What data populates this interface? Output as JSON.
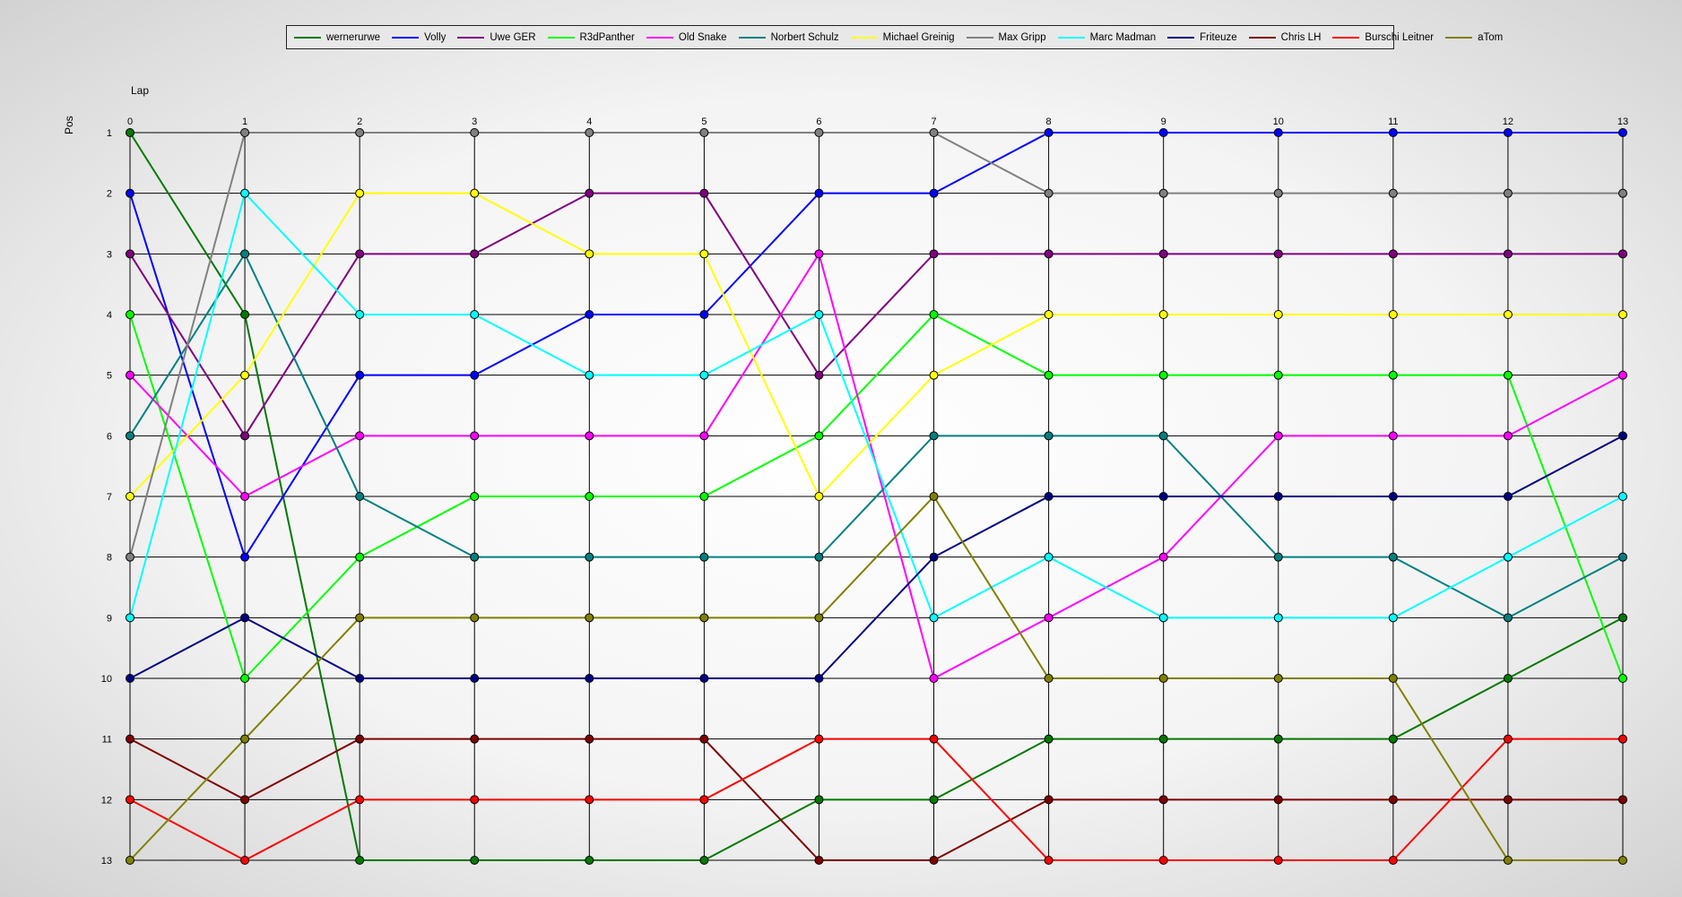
{
  "chart_data": {
    "type": "line",
    "title": "",
    "xlabel": "Lap",
    "ylabel": "Pos",
    "x": [
      0,
      1,
      2,
      3,
      4,
      5,
      6,
      7,
      8,
      9,
      10,
      11,
      12,
      13
    ],
    "y_ticks": [
      1,
      2,
      3,
      4,
      5,
      6,
      7,
      8,
      9,
      10,
      11,
      12,
      13
    ],
    "ylim": [
      1,
      13
    ],
    "y_inverted": true,
    "grid": true,
    "legend_position": "top-center",
    "series": [
      {
        "name": "wernerurwe",
        "color": "#007a00",
        "values": [
          1,
          4,
          13,
          13,
          13,
          13,
          12,
          12,
          11,
          11,
          11,
          11,
          10,
          9
        ]
      },
      {
        "name": "Volly",
        "color": "#0000ff",
        "values": [
          2,
          8,
          5,
          5,
          4,
          4,
          2,
          2,
          1,
          1,
          1,
          1,
          1,
          1
        ]
      },
      {
        "name": "Uwe GER",
        "color": "#800080",
        "values": [
          3,
          6,
          3,
          3,
          2,
          2,
          5,
          3,
          3,
          3,
          3,
          3,
          3,
          3
        ]
      },
      {
        "name": "R3dPanther",
        "color": "#00ff00",
        "values": [
          4,
          10,
          8,
          7,
          7,
          7,
          6,
          4,
          5,
          5,
          5,
          5,
          5,
          10
        ]
      },
      {
        "name": "Old Snake",
        "color": "#ff00ff",
        "values": [
          5,
          7,
          6,
          6,
          6,
          6,
          3,
          10,
          9,
          8,
          6,
          6,
          6,
          5
        ]
      },
      {
        "name": "Norbert Schulz",
        "color": "#008080",
        "values": [
          6,
          3,
          7,
          8,
          8,
          8,
          8,
          6,
          6,
          6,
          8,
          8,
          9,
          8
        ]
      },
      {
        "name": "Michael Greinig",
        "color": "#ffff00",
        "values": [
          7,
          5,
          2,
          2,
          3,
          3,
          7,
          5,
          4,
          4,
          4,
          4,
          4,
          4
        ]
      },
      {
        "name": "Max Gripp",
        "color": "#808080",
        "values": [
          8,
          1,
          1,
          1,
          1,
          1,
          1,
          1,
          2,
          2,
          2,
          2,
          2,
          2
        ]
      },
      {
        "name": "Marc Madman",
        "color": "#00ffff",
        "values": [
          9,
          2,
          4,
          4,
          5,
          5,
          4,
          9,
          8,
          9,
          9,
          9,
          8,
          7
        ]
      },
      {
        "name": "Friteuze",
        "color": "#000080",
        "values": [
          10,
          9,
          10,
          10,
          10,
          10,
          10,
          8,
          7,
          7,
          7,
          7,
          7,
          6
        ]
      },
      {
        "name": "Chris LH",
        "color": "#800000",
        "values": [
          11,
          12,
          11,
          11,
          11,
          11,
          13,
          13,
          12,
          12,
          12,
          12,
          12,
          12
        ]
      },
      {
        "name": "Burschi Leitner",
        "color": "#ff0000",
        "values": [
          12,
          13,
          12,
          12,
          12,
          12,
          11,
          11,
          13,
          13,
          13,
          13,
          11,
          11
        ]
      },
      {
        "name": "aTom",
        "color": "#808000",
        "values": [
          13,
          11,
          9,
          9,
          9,
          9,
          9,
          7,
          10,
          10,
          10,
          10,
          13,
          13
        ]
      }
    ]
  }
}
